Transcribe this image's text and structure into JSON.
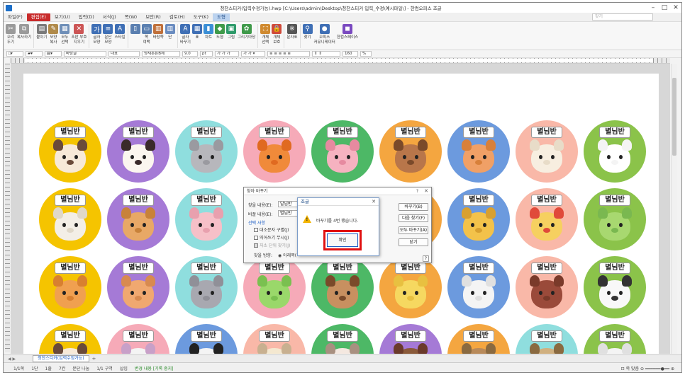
{
  "window": {
    "title": "청찬스티커(입력수정가능).hwp [C:\\Users\\admin\\Desktop\\청찬스티커 입력_수정\\예시파일\\] - 한컴오피스 조글"
  },
  "menubar": {
    "items": [
      "파일(F)",
      "편집(E)",
      "보기(U)",
      "입력(D)",
      "서식(J)",
      "쪽(W)",
      "보안(R)",
      "검토(H)",
      "도구(K)",
      "도형"
    ],
    "active_index": 1,
    "shape_tab_index": 9,
    "search_placeholder": "찾기"
  },
  "ribbon": {
    "items": [
      {
        "label": "오려\n두기",
        "icon": "scissors-icon",
        "color": "#9a9a9a",
        "glyph": "✂"
      },
      {
        "label": "복사하기",
        "icon": "copy-icon",
        "color": "#9a9a9a",
        "glyph": "⧉"
      },
      {
        "label": "붙이기",
        "icon": "paste-icon",
        "color": "#7a7a7a",
        "glyph": "▤"
      },
      {
        "label": "모양\n복사",
        "icon": "format-painter-icon",
        "color": "#b08a4a",
        "glyph": "✎"
      },
      {
        "label": "모두\n선택",
        "icon": "select-all-icon",
        "color": "#6f8fb8",
        "glyph": "▦"
      },
      {
        "label": "조판 부호\n지우기",
        "icon": "clear-format-icon",
        "color": "#c55",
        "glyph": "✕"
      },
      {
        "label": "글자\n모양",
        "icon": "char-shape-icon",
        "color": "#3f6fb5",
        "glyph": "가"
      },
      {
        "label": "문단\n모양",
        "icon": "para-shape-icon",
        "color": "#3f6fb5",
        "glyph": "≡"
      },
      {
        "label": "스타일",
        "icon": "style-icon",
        "color": "#3f6fb5",
        "glyph": "A"
      },
      {
        "label": "",
        "icon": "page-icon",
        "color": "#5a7fb0",
        "glyph": "▯"
      },
      {
        "label": "쪽\n여백",
        "icon": "margin-icon",
        "color": "#5a7fb0",
        "glyph": "▭"
      },
      {
        "label": "바탕쪽",
        "icon": "master-page-icon",
        "color": "#c0703a",
        "glyph": "▥"
      },
      {
        "label": "단",
        "icon": "column-icon",
        "color": "#6a8cc0",
        "glyph": "▥"
      },
      {
        "label": "글자\n바꾸기",
        "icon": "char-replace-icon",
        "color": "#3f6fb5",
        "glyph": "A"
      },
      {
        "label": "표",
        "icon": "table-icon",
        "color": "#3f6fb5",
        "glyph": "▦"
      },
      {
        "label": "차트",
        "icon": "chart-icon",
        "color": "#3b8fd6",
        "glyph": "▮"
      },
      {
        "label": "도형",
        "icon": "shape-icon",
        "color": "#3f9a4a",
        "glyph": "◆"
      },
      {
        "label": "그림",
        "icon": "picture-icon",
        "color": "#2e9a6a",
        "glyph": "▣"
      },
      {
        "label": "그리기마당",
        "icon": "clipart-icon",
        "color": "#3f9a4a",
        "glyph": "✿"
      },
      {
        "label": "개체\n선택",
        "icon": "object-select-icon",
        "color": "#d08a30",
        "glyph": "⬚"
      },
      {
        "label": "개체\n보호",
        "icon": "object-protect-icon",
        "color": "#d04a3a",
        "glyph": "🔒"
      },
      {
        "label": "문자표",
        "icon": "symbol-icon",
        "color": "#555",
        "glyph": "※"
      },
      {
        "label": "찾기",
        "icon": "find-icon",
        "color": "#3f6fb5",
        "glyph": "⚲"
      },
      {
        "label": "오피스\n커뮤니케이터",
        "icon": "communicator-icon",
        "color": "#3f6fb5",
        "glyph": "●"
      },
      {
        "label": "한컴스페이스",
        "icon": "hancom-space-icon",
        "color": "#7a4ac0",
        "glyph": "◼"
      }
    ]
  },
  "formatbar": {
    "style": "바탕글",
    "lang": "대표",
    "font": "양재튼튼B체",
    "size": "9.0",
    "unit": "pt",
    "zoom": "160",
    "zoom_unit": "%"
  },
  "stickers": {
    "label": "별님반",
    "rows": [
      [
        {
          "bg": "#f5c400",
          "face": "#f7e9d8",
          "ear": "#6a4a3a",
          "animal": "dog-face-icon"
        },
        {
          "bg": "#a57ad6",
          "face": "#fbf6ef",
          "ear": "#3a2a2a",
          "animal": "cow-face-icon"
        },
        {
          "bg": "#8fdede",
          "face": "#b7b7bc",
          "ear": "#9a9aa0",
          "animal": "mouse-face-icon"
        },
        {
          "bg": "#f6aab8",
          "face": "#f08a3a",
          "ear": "#e06a20",
          "animal": "fox-face-icon"
        },
        {
          "bg": "#4db866",
          "face": "#f6b2c0",
          "ear": "#e68aa0",
          "animal": "pig-face-icon"
        },
        {
          "bg": "#f4a640",
          "face": "#b8764a",
          "ear": "#7a4a2a",
          "animal": "horse-face-icon"
        },
        {
          "bg": "#6c9ade",
          "face": "#f0a066",
          "ear": "#d8803a",
          "animal": "cat-face-icon"
        },
        {
          "bg": "#f9b8a8",
          "face": "#f7eee0",
          "ear": "#e8dcc8",
          "animal": "sheep-face-icon"
        },
        {
          "bg": "#8bc34a",
          "face": "#ffffff",
          "ear": "#f4f4f4",
          "animal": "rabbit-face-icon"
        }
      ],
      [
        {
          "bg": "#f5c400",
          "face": "#f3eee6",
          "ear": "#e0d8c8",
          "animal": "sheep-face-icon"
        },
        {
          "bg": "#a57ad6",
          "face": "#e8a866",
          "ear": "#c8823a",
          "animal": "bear-face-icon"
        },
        {
          "bg": "#8fdede",
          "face": "#f6c0c8",
          "ear": "#e8a0ae",
          "animal": "pig-face-icon"
        },
        {
          "bg": "#f6aab8",
          "face": "#f4f4f4",
          "ear": "#dddddd",
          "animal": "lamb-face-icon"
        },
        {
          "bg": "#4db866",
          "face": "#f0c070",
          "ear": "#c89040",
          "animal": "monkey-face-icon"
        },
        {
          "bg": "#f4a640",
          "face": "#f0b060",
          "ear": "#d89040",
          "animal": "lion-face-icon"
        },
        {
          "bg": "#6c9ade",
          "face": "#f3c24a",
          "ear": "#d8a030",
          "animal": "tiger-face-icon"
        },
        {
          "bg": "#f9b8a8",
          "face": "#f6d060",
          "ear": "#e04a3a",
          "animal": "chick-face-icon"
        },
        {
          "bg": "#8bc34a",
          "face": "#a8d870",
          "ear": "#7ab850",
          "animal": "turtle-face-icon"
        }
      ],
      [
        {
          "bg": "#f5c400",
          "face": "#f0a050",
          "ear": "#d88030",
          "animal": "tiger-face-icon"
        },
        {
          "bg": "#a57ad6",
          "face": "#f0a870",
          "ear": "#d88a50",
          "animal": "cat-face-icon"
        },
        {
          "bg": "#8fdede",
          "face": "#a8a8b0",
          "ear": "#909098",
          "animal": "elephant-face-icon"
        },
        {
          "bg": "#f6aab8",
          "face": "#9ad86a",
          "ear": "#7ac050",
          "animal": "frog-face-icon"
        },
        {
          "bg": "#4db866",
          "face": "#c89060",
          "ear": "#7a4a2a",
          "animal": "puppy-face-icon"
        },
        {
          "bg": "#f4a640",
          "face": "#f6d860",
          "ear": "#e8c040",
          "animal": "chick-face-icon"
        },
        {
          "bg": "#6c9ade",
          "face": "#f4f4f4",
          "ear": "#e0e0e0",
          "animal": "polar-bear-face-icon"
        },
        {
          "bg": "#f9b8a8",
          "face": "#9a4a3a",
          "ear": "#7a3a2a",
          "animal": "horse-face-icon"
        },
        {
          "bg": "#8bc34a",
          "face": "#f8f8f8",
          "ear": "#333333",
          "animal": "cow-face-icon"
        }
      ],
      [
        {
          "bg": "#f5c400",
          "face": "#f7e9d8",
          "ear": "#6a4a3a",
          "animal": "dog-face-icon"
        },
        {
          "bg": "#f6aab8",
          "face": "#f4f4f4",
          "ear": "#c8a0c8",
          "animal": "rabbit-face-icon"
        },
        {
          "bg": "#6c9ade",
          "face": "#f4f4f4",
          "ear": "#222222",
          "animal": "panda-face-icon"
        },
        {
          "bg": "#f9b8a8",
          "face": "#f4e8d0",
          "ear": "#c8b090",
          "animal": "goat-face-icon"
        },
        {
          "bg": "#4db866",
          "face": "#f4e8e0",
          "ear": "#a89080",
          "animal": "donkey-face-icon"
        },
        {
          "bg": "#a57ad6",
          "face": "#8a5a3a",
          "ear": "#6a3a2a",
          "animal": "bear-face-icon"
        },
        {
          "bg": "#f4a640",
          "face": "#b88a5a",
          "ear": "#8a6a40",
          "animal": "bear-face-icon"
        },
        {
          "bg": "#8fdede",
          "face": "#d0b080",
          "ear": "#8a6a40",
          "animal": "deer-face-icon"
        },
        {
          "bg": "#8bc34a",
          "face": "#f4f4f4",
          "ear": "#e0e0e0",
          "animal": "lamb-face-icon"
        }
      ]
    ]
  },
  "find_replace_dialog": {
    "title": "찾아 바꾸기",
    "help": "?",
    "find_label": "찾을 내용(E):",
    "find_value": "달님반",
    "replace_label": "바꿀 내용(E):",
    "replace_value": "별님반",
    "options_label": "선택 사항",
    "opt_case": "대소문자 구별(J)",
    "opt_space": "띄어쓰기 무시(J)",
    "opt_whole": "자소 단위 찾기(J)",
    "direction_label": "찾을 방향:",
    "direction_value": "아래쪽(",
    "btn_replace": "바꾸기(B)",
    "btn_next": "다음 찾기(F)",
    "btn_replace_all": "모두 바꾸기(A)",
    "btn_close": "닫기",
    "help_small": "?"
  },
  "alert_dialog": {
    "title": "조글",
    "message": "바꾸기를 4번 했습니다.",
    "ok_label": "확인"
  },
  "sheet_tab": {
    "label": "청찬스티커(입력수정가능)",
    "add": "+"
  },
  "statusbar": {
    "items": [
      "1/1쪽",
      "1단",
      "1줄",
      "7칸",
      "문단 나눔",
      "1/1 구역",
      "삽입"
    ],
    "change_tracking": "변경 내용 [기록 중지]",
    "zoom_mode": "쪽 맞춤"
  }
}
